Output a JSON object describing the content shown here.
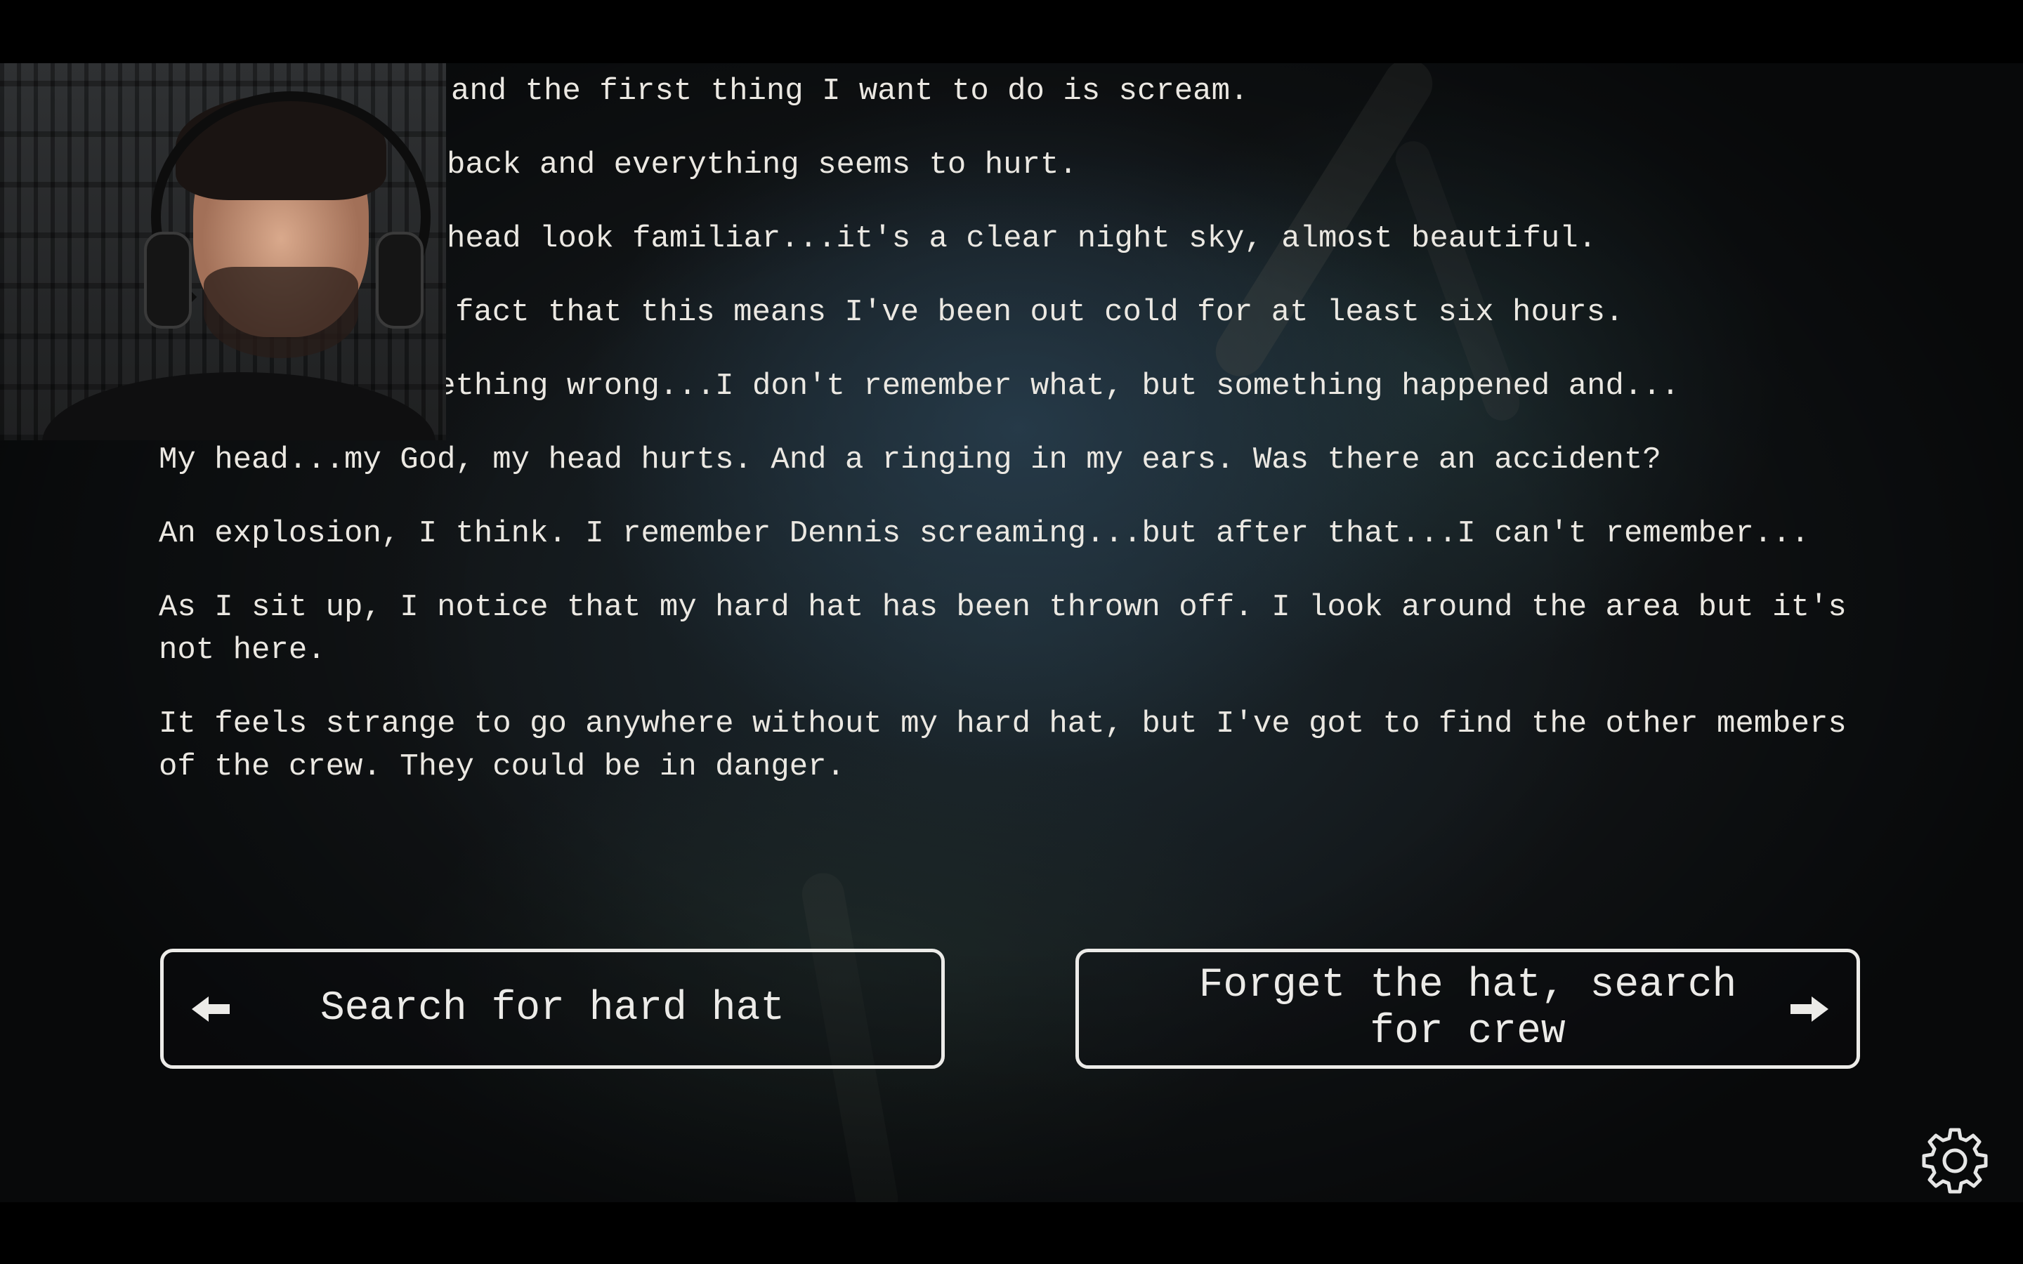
{
  "story": {
    "lines": [
      "and the first thing I want to do is scream.",
      "back and everything seems to hurt.",
      "head look familiar...it's a clear night sky, almost beautiful.",
      "fact that this means I've been out cold for at least six hours.",
      "But there's something wrong...I don't remember what, but something happened and...",
      "My head...my God, my head hurts. And a ringing in my ears. Was there an accident?",
      "An explosion, I think. I remember Dennis screaming...but after that...I can't remember...",
      "As I sit up, I notice that my hard hat has been thrown off. I look around the area but it's not here.",
      "It feels strange to go anywhere without my hard hat, but I've got to find the other members of the crew. They could be in danger."
    ]
  },
  "choices": {
    "left_label": "Search for hard hat",
    "right_label": "Forget the hat, search for crew",
    "left_icon": "arrow-left-icon",
    "right_icon": "arrow-right-icon"
  },
  "settings": {
    "icon": "gear-icon"
  },
  "colors": {
    "text": "#ebe8e2",
    "button_border": "#ecebe8",
    "background": "#111416"
  }
}
